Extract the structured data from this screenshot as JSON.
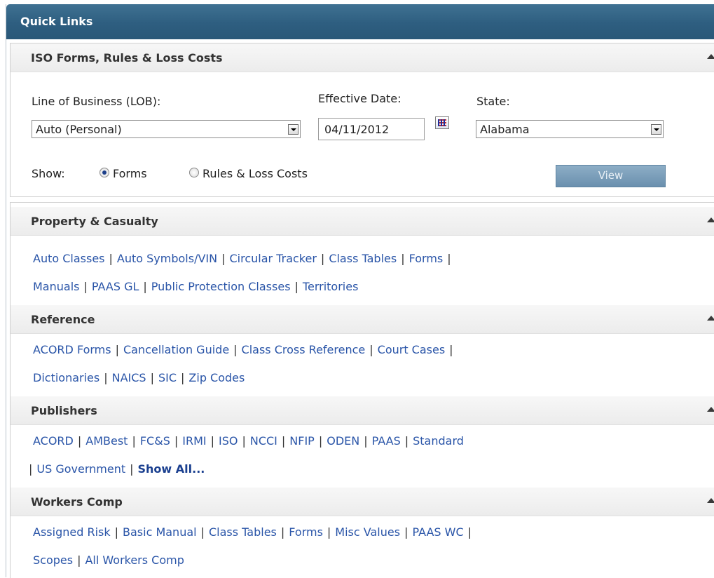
{
  "panel": {
    "title": "Quick Links"
  },
  "iso": {
    "heading": "ISO Forms, Rules & Loss Costs",
    "lob_label": "Line of Business (LOB):",
    "lob_value": "Auto (Personal)",
    "date_label": "Effective Date:",
    "date_value": "04/11/2012",
    "state_label": "State:",
    "state_value": "Alabama",
    "show_label": "Show:",
    "radio_forms": "Forms",
    "radio_rules": "Rules & Loss Costs",
    "selected": "Forms",
    "view_button": "View"
  },
  "sections": {
    "pc": {
      "heading": "Property & Casualty",
      "links": [
        "Auto Classes",
        "Auto Symbols/VIN",
        "Circular Tracker",
        "Class Tables",
        "Forms",
        "Manuals",
        "PAAS GL",
        "Public Protection Classes",
        "Territories"
      ]
    },
    "reference": {
      "heading": "Reference",
      "links": [
        "ACORD Forms",
        "Cancellation Guide",
        "Class Cross Reference",
        "Court Cases",
        "Dictionaries",
        "NAICS",
        "SIC",
        "Zip Codes"
      ]
    },
    "publishers": {
      "heading": "Publishers",
      "links": [
        "ACORD",
        "AMBest",
        "FC&S",
        "IRMI",
        "ISO",
        "NCCI",
        "NFIP",
        "ODEN",
        "PAAS",
        "Standard",
        "US Government"
      ],
      "show_all": "Show All..."
    },
    "workers": {
      "heading": "Workers Comp",
      "links": [
        "Assigned Risk",
        "Basic Manual",
        "Class Tables",
        "Forms",
        "Misc Values",
        "PAAS WC",
        "Scopes",
        "All Workers Comp"
      ]
    }
  },
  "colors": {
    "title_bar": "#2e5e80",
    "link": "#2a55a8",
    "view_button": "#7b9fba"
  }
}
